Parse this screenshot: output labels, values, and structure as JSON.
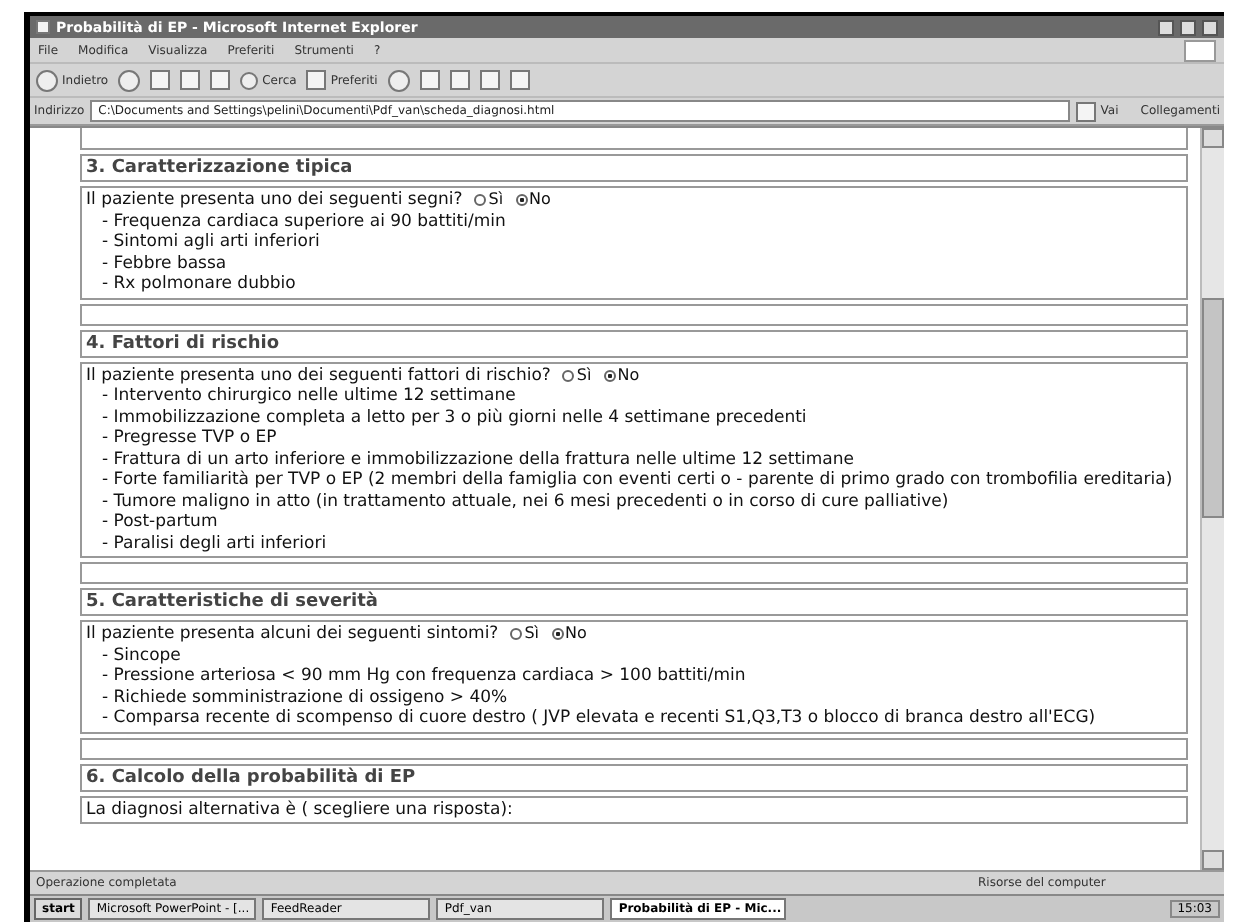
{
  "window": {
    "title": "Probabilità di EP - Microsoft Internet Explorer"
  },
  "menu": [
    "File",
    "Modifica",
    "Visualizza",
    "Preferiti",
    "Strumenti",
    "?"
  ],
  "toolbar": {
    "back": "Indietro",
    "search": "Cerca",
    "favorites": "Preferiti"
  },
  "address": {
    "label": "Indirizzo",
    "value": "C:\\Documents and Settings\\pelini\\Documenti\\Pdf_van\\scheda_diagnosi.html",
    "go": "Vai",
    "links": "Collegamenti"
  },
  "sections": [
    {
      "title": "3. Caratterizzazione tipica",
      "question": "Il paziente presenta uno dei seguenti segni?",
      "options": [
        {
          "label": "Sì",
          "selected": false
        },
        {
          "label": "No",
          "selected": true
        }
      ],
      "items": [
        "- Frequenza cardiaca superiore ai 90 battiti/min",
        "- Sintomi agli arti inferiori",
        "- Febbre bassa",
        "- Rx polmonare dubbio"
      ]
    },
    {
      "title": "4. Fattori di rischio",
      "question": "Il paziente presenta uno dei seguenti fattori di rischio?",
      "options": [
        {
          "label": "Sì",
          "selected": false
        },
        {
          "label": "No",
          "selected": true
        }
      ],
      "items": [
        "- Intervento chirurgico nelle ultime 12 settimane",
        "- Immobilizzazione completa a letto per 3 o più giorni nelle 4 settimane precedenti",
        "- Pregresse TVP o EP",
        "- Frattura di un arto inferiore e immobilizzazione della frattura nelle ultime 12 settimane",
        "- Forte familiarità per TVP o EP (2 membri della famiglia con eventi certi o - parente di primo grado con trombofilia ereditaria)",
        "- Tumore maligno in atto (in trattamento attuale, nei 6 mesi precedenti o in corso di cure palliative)",
        "- Post-partum",
        "- Paralisi degli arti inferiori"
      ]
    },
    {
      "title": "5. Caratteristiche di severità",
      "question": "Il paziente presenta alcuni dei seguenti sintomi?",
      "options": [
        {
          "label": "Sì",
          "selected": false
        },
        {
          "label": "No",
          "selected": true
        }
      ],
      "items": [
        "- Sincope",
        "- Pressione arteriosa < 90 mm Hg con frequenza cardiaca > 100 battiti/min",
        "- Richiede somministrazione di ossigeno > 40%",
        "- Comparsa recente di scompenso di cuore destro ( JVP elevata e recenti S1,Q3,T3 o blocco di branca destro all'ECG)"
      ]
    },
    {
      "title": "6. Calcolo della probabilità di EP",
      "question": "La diagnosi alternativa è ( scegliere una risposta):"
    }
  ],
  "status_bar": {
    "text": "Operazione completata",
    "zone": "Risorse del computer"
  },
  "taskbar": {
    "start": "start",
    "buttons": [
      {
        "label": "Microsoft PowerPoint - [...",
        "selected": false
      },
      {
        "label": "FeedReader",
        "selected": false
      },
      {
        "label": "Pdf_van",
        "selected": false
      },
      {
        "label": "Probabilità di EP - Mic...",
        "selected": true
      }
    ],
    "clock": "15:03"
  }
}
